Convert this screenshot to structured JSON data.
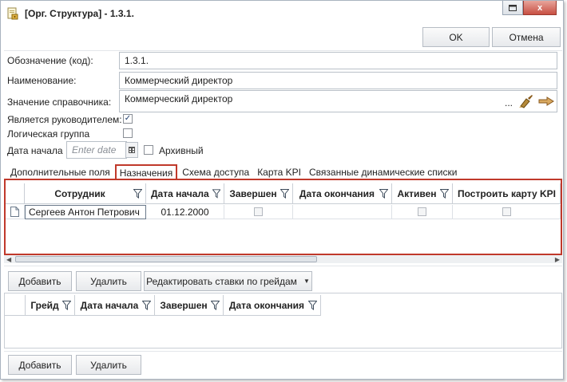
{
  "window": {
    "title": "[Орг. Структура] - 1.3.1.",
    "minimize_icon": "restore-icon",
    "close_label": "x"
  },
  "toolbar": {
    "ok_label": "OK",
    "cancel_label": "Отмена"
  },
  "form": {
    "code_label": "Обозначение (код):",
    "code_value": "1.3.1.",
    "name_label": "Наименование:",
    "name_value": "Коммерческий директор",
    "ref_label": "Значение справочника:",
    "ref_value": "Коммерческий директор",
    "ref_ellipsis": "...",
    "is_head_label": "Является руководителем:",
    "is_head_checked": true,
    "is_head_mark": "✓",
    "logical_group_label": "Логическая группа",
    "logical_group_checked": false,
    "start_date_label": "Дата начала",
    "start_date_placeholder": "Enter date",
    "archive_label": "Архивный",
    "archive_checked": false
  },
  "tabs": [
    {
      "label": "Дополнительные поля",
      "active": false
    },
    {
      "label": "Назначения",
      "active": true
    },
    {
      "label": "Схема доступа",
      "active": false
    },
    {
      "label": "Карта KPI",
      "active": false
    },
    {
      "label": "Связанные динамические списки",
      "active": false
    }
  ],
  "assignments": {
    "columns": [
      "Сотрудник",
      "Дата начала",
      "Завершен",
      "Дата окончания",
      "Активен",
      "Построить карту KPI"
    ],
    "rows": [
      {
        "employee": "Сергеев Антон Петрович",
        "start": "01.12.2000",
        "completed": false,
        "end": "",
        "active": false,
        "kpi": false
      }
    ]
  },
  "assignment_buttons": {
    "add_label": "Добавить",
    "delete_label": "Удалить",
    "edit_rates_label": "Редактировать ставки по грейдам"
  },
  "grades": {
    "columns": [
      "Грейд",
      "Дата начала",
      "Завершен",
      "Дата окончания"
    ],
    "rows": []
  },
  "grade_buttons": {
    "add_label": "Добавить",
    "delete_label": "Удалить"
  },
  "colors": {
    "highlight": "#c0392b",
    "border": "#b9c0c8"
  }
}
